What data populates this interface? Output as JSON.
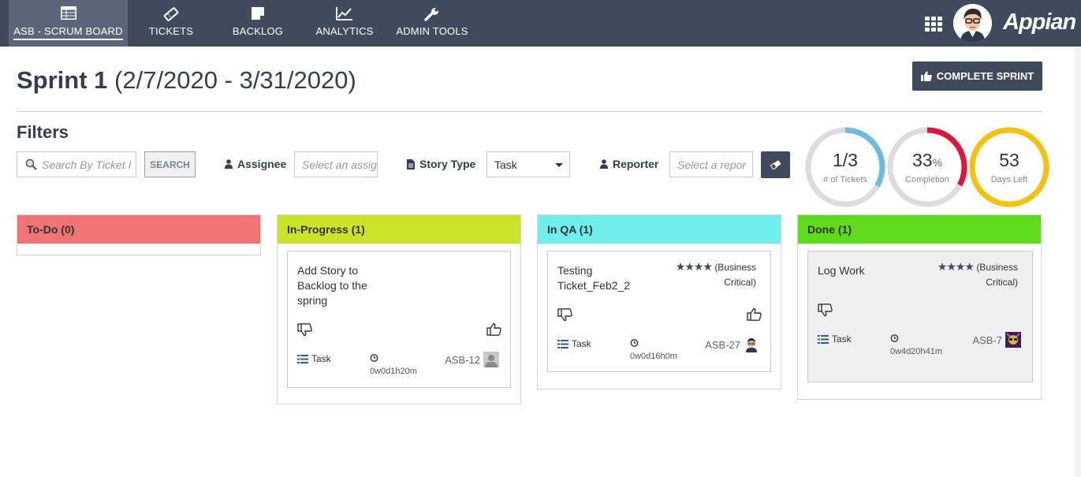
{
  "nav": {
    "items": [
      {
        "label": "ASB - SCRUM BOARD",
        "icon": "table-icon",
        "active": true
      },
      {
        "label": "TICKETS",
        "icon": "ticket-icon"
      },
      {
        "label": "BACKLOG",
        "icon": "note-icon"
      },
      {
        "label": "ANALYTICS",
        "icon": "line-chart-icon"
      },
      {
        "label": "ADMIN TOOLS",
        "icon": "wrench-icon"
      }
    ],
    "brand": "Appian"
  },
  "header": {
    "sprint_name": "Sprint 1",
    "sprint_dates": "(2/7/2020 - 3/31/2020)",
    "complete_label": "COMPLETE SPRINT"
  },
  "filters": {
    "title": "Filters",
    "search_placeholder": "Search By Ticket I",
    "search_button": "SEARCH",
    "assignee_label": "Assignee",
    "assignee_placeholder": "Select an assig",
    "story_type_label": "Story Type",
    "story_type_value": "Task",
    "reporter_label": "Reporter",
    "reporter_placeholder": "Select a repor"
  },
  "gauges": [
    {
      "value": "1/3",
      "unit": "",
      "label": "# of Tickets",
      "fraction": 0.3333,
      "color": "#6cb9e2"
    },
    {
      "value": "33",
      "unit": "%",
      "label": "Completion",
      "fraction": 0.33,
      "color": "#e0143c"
    },
    {
      "value": "53",
      "unit": "",
      "label": "Days Left",
      "fraction": 1.0,
      "color": "#f4c20d"
    }
  ],
  "columns": [
    {
      "title": "To-Do (0)",
      "color": "#f07474"
    },
    {
      "title": "In-Progress (1)",
      "color": "#cde32a"
    },
    {
      "title": "In QA (1)",
      "color": "#70eeee"
    },
    {
      "title": "Done (1)",
      "color": "#5fdc1e"
    }
  ],
  "cards": [
    {
      "title": "Add Story to Backlog to the spring",
      "type": "Task",
      "time": "0w0d1h20m",
      "id": "ASB-12",
      "priority_stars": "",
      "priority_text": ""
    },
    {
      "title": "Testing Ticket_Feb2_2",
      "type": "Task",
      "time": "0w0d16h0m",
      "id": "ASB-27",
      "priority_stars": "★★★★",
      "priority_text": "(Business Critical)"
    },
    {
      "title": "Log Work",
      "type": "Task",
      "time": "0w4d20h41m",
      "id": "ASB-7",
      "priority_stars": "★★★★",
      "priority_text": "(Business Critical)"
    }
  ]
}
